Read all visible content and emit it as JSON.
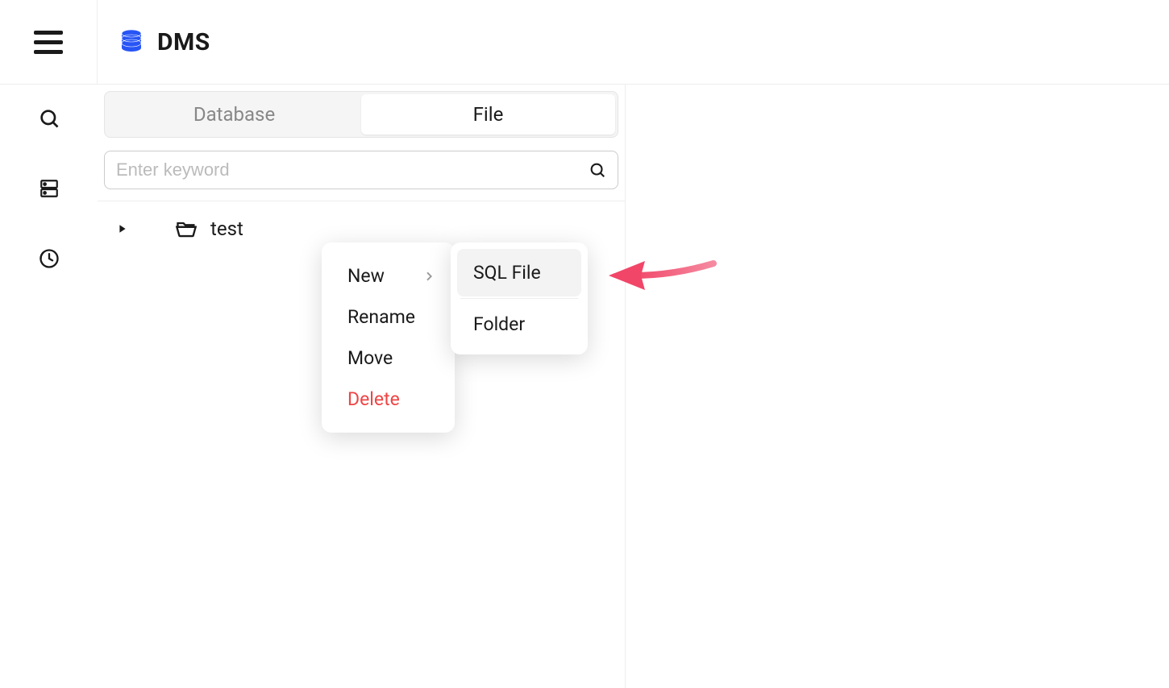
{
  "header": {
    "app_title": "DMS"
  },
  "tabs": {
    "database": "Database",
    "file": "File",
    "active": "file"
  },
  "search": {
    "placeholder": "Enter keyword"
  },
  "tree": {
    "items": [
      {
        "name": "test",
        "type": "folder"
      }
    ]
  },
  "context_menu": {
    "new": "New",
    "rename": "Rename",
    "move": "Move",
    "delete": "Delete"
  },
  "submenu": {
    "sql_file": "SQL File",
    "folder": "Folder"
  },
  "colors": {
    "brand_blue": "#2755f5",
    "danger": "#ef4444",
    "arrow": "#f14668"
  }
}
